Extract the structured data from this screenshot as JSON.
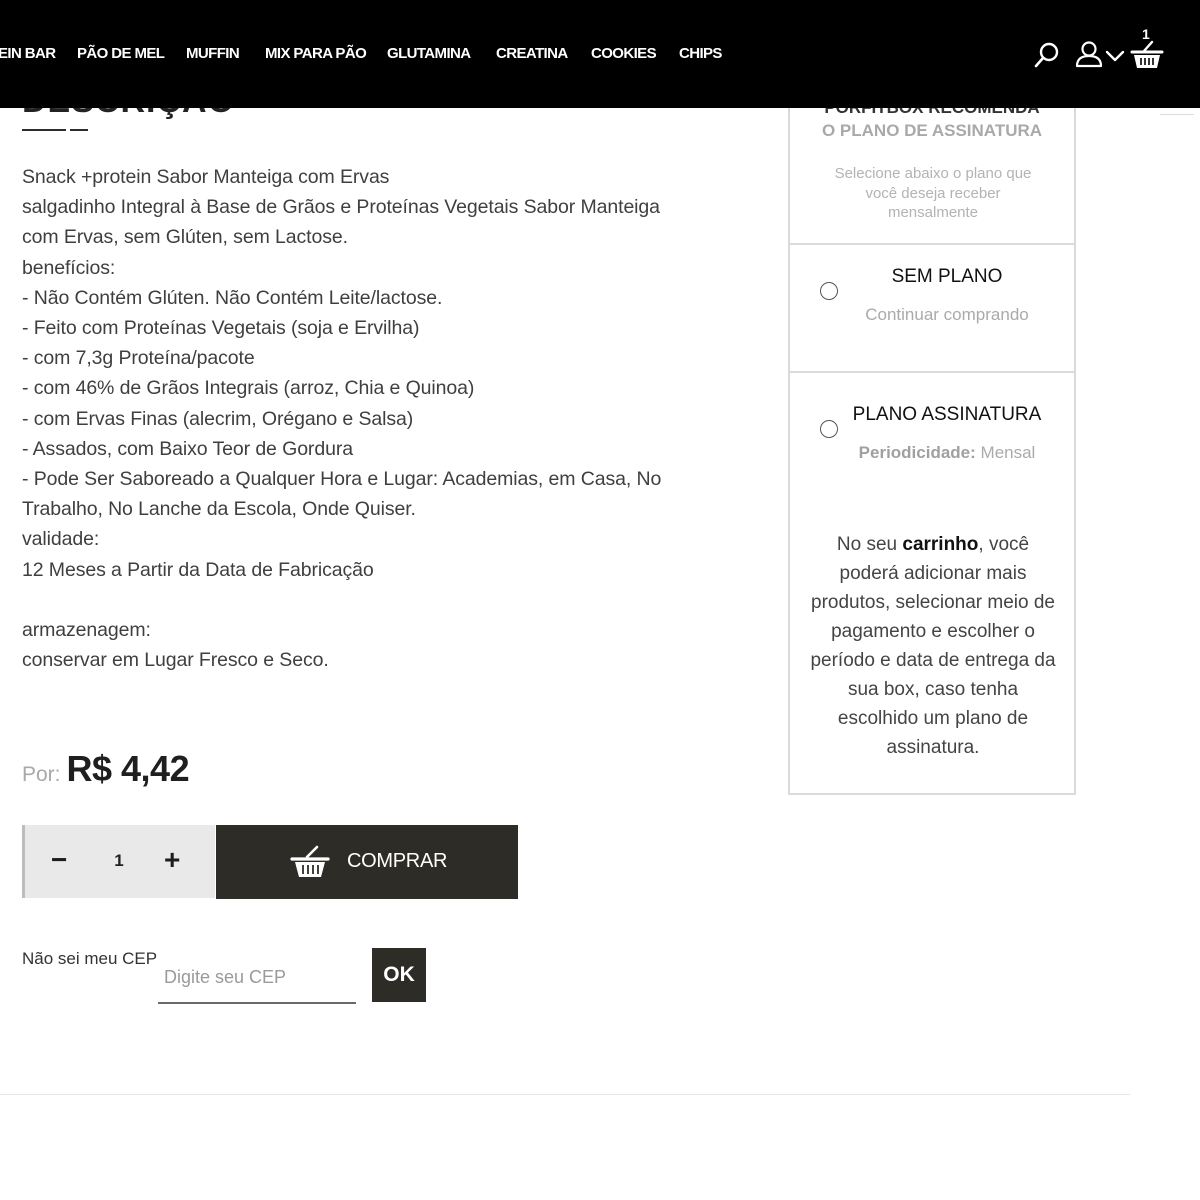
{
  "nav": {
    "items": [
      "EIN BAR",
      "PÃO DE MEL",
      "MUFFIN",
      "MIX PARA PÃO",
      "GLUTAMINA",
      "CREATINA",
      "COOKIES",
      "CHIPS"
    ],
    "cart_count": "1",
    "icons": [
      "search-icon",
      "user-icon",
      "chevron-down-icon",
      "cart-icon"
    ]
  },
  "description": {
    "heading": "DESCRIÇÃO",
    "lines": [
      "Snack +protein Sabor Manteiga com Ervas",
      "salgadinho Integral à Base de Grãos e Proteínas Vegetais Sabor Manteiga",
      "com Ervas, sem Glúten, sem Lactose.",
      "benefícios:",
      "- Não Contém Glúten. Não Contém Leite/lactose.",
      "- Feito com Proteínas Vegetais (soja e Ervilha)",
      "- com 7,3g Proteína/pacote",
      "- com 46% de Grãos Integrais (arroz, Chia e Quinoa)",
      "- com Ervas Finas (alecrim, Orégano e Salsa)",
      "- Assados, com Baixo Teor de Gordura",
      "- Pode Ser Saboreado a Qualquer Hora e Lugar: Academias, em Casa, No",
      "Trabalho, No Lanche da Escola, Onde Quiser.",
      "validade:",
      "12 Meses a Partir da Data de Fabricação",
      "",
      "armazenagem:",
      "conservar em Lugar Fresco e Seco."
    ]
  },
  "price": {
    "prefix": "Por:",
    "value": "R$ 4,42"
  },
  "purchase": {
    "quantity": "1",
    "minus_label": "−",
    "plus_label": "+",
    "buy_label": "COMPRAR"
  },
  "cep": {
    "label": "Não sei meu CEP",
    "placeholder": "Digite seu CEP",
    "value": "",
    "ok_label": "OK"
  },
  "panel": {
    "recommend_title": "PORFITBOX RECOMENDA",
    "recommend_subtitle": "O PLANO DE ASSINATURA",
    "recommend_note": "Selecione abaixo o plano que você deseja receber mensalmente",
    "plan_none_title": "SEM PLANO",
    "plan_none_sub": "Continuar comprando",
    "plan_sub_title": "PLANO ASSINATURA",
    "plan_sub_period_label": "Periodicidade:",
    "plan_sub_period_value": "Mensal",
    "info_pre": "No seu ",
    "info_bold": "carrinho",
    "info_post": ", você poderá adicionar mais produtos, selecionar meio de pagamento e escolher o período e data de entrega da sua box, caso tenha escolhido um plano de assinatura."
  },
  "colors": {
    "topbar": "#000000",
    "button_dark": "#2e2c27",
    "text": "#3f3f3f",
    "muted": "#a9a9a9"
  }
}
